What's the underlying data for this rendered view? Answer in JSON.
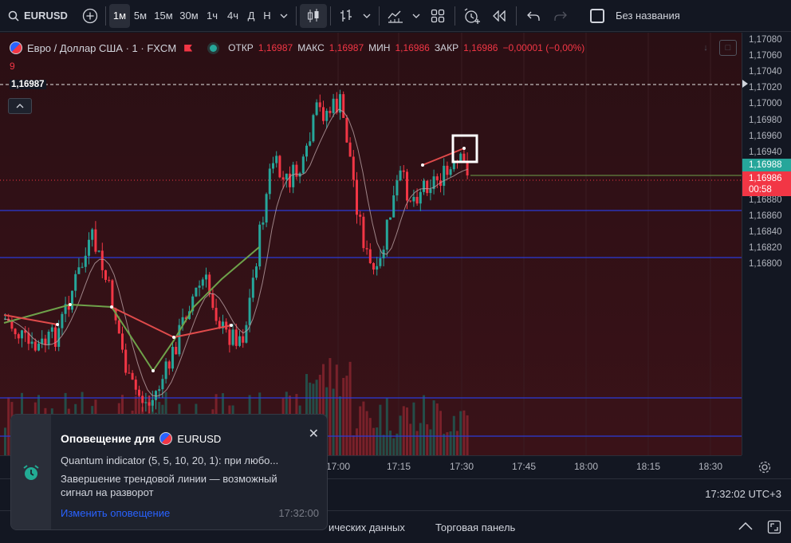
{
  "toolbar": {
    "symbol": "EURUSD",
    "timeframes": [
      "1м",
      "5м",
      "15м",
      "30м",
      "1ч",
      "4ч",
      "Д",
      "Н"
    ],
    "active_timeframe": "1м",
    "layout_name": "Без названия"
  },
  "legend": {
    "title": "Евро / Доллар США · 1 · FXCM",
    "open_label": "ОТКР",
    "open_value": "1,16987",
    "high_label": "МАКС",
    "high_value": "1,16987",
    "low_label": "МИН",
    "low_value": "1,16986",
    "close_label": "ЗАКР",
    "close_value": "1,16986",
    "change": "−0,00001 (−0,00%)",
    "sub_value": "9",
    "line_price": "1,16987"
  },
  "price_scale": {
    "ticks": [
      "1,17080",
      "1,17060",
      "1,17040",
      "1,17020",
      "1,17000",
      "1,16980",
      "1,16960",
      "1,16940",
      "1,16920",
      "1,16900",
      "1,16880",
      "1,16860",
      "1,16840",
      "1,16820",
      "1,16800"
    ],
    "label_green": "1,16988",
    "label_red": "1,16986",
    "countdown": "00:58"
  },
  "time_axis": {
    "ticks": [
      "17:00",
      "17:15",
      "17:30",
      "17:45",
      "18:00",
      "18:15",
      "18:30"
    ]
  },
  "status": {
    "clock": "17:32:02 UTC+3"
  },
  "bottom_panel": {
    "tab_data": "ических данных",
    "tab_trading": "Торговая панель"
  },
  "notification": {
    "title": "Оповещение для",
    "symbol": "EURUSD",
    "line1": "Quantum indicator (5, 5, 10, 20, 1): при любо...",
    "line2": "Завершение трендовой линии — возможный",
    "line3": "сигнал на разворот",
    "link": "Изменить оповещение",
    "time": "17:32:00"
  },
  "colors": {
    "up": "#26a69a",
    "down": "#f23645",
    "bg": "#131722",
    "accent": "#2962ff",
    "hline": "#2962ff",
    "trend_green": "#6ea24a",
    "trend_red": "#e04b4b"
  }
}
